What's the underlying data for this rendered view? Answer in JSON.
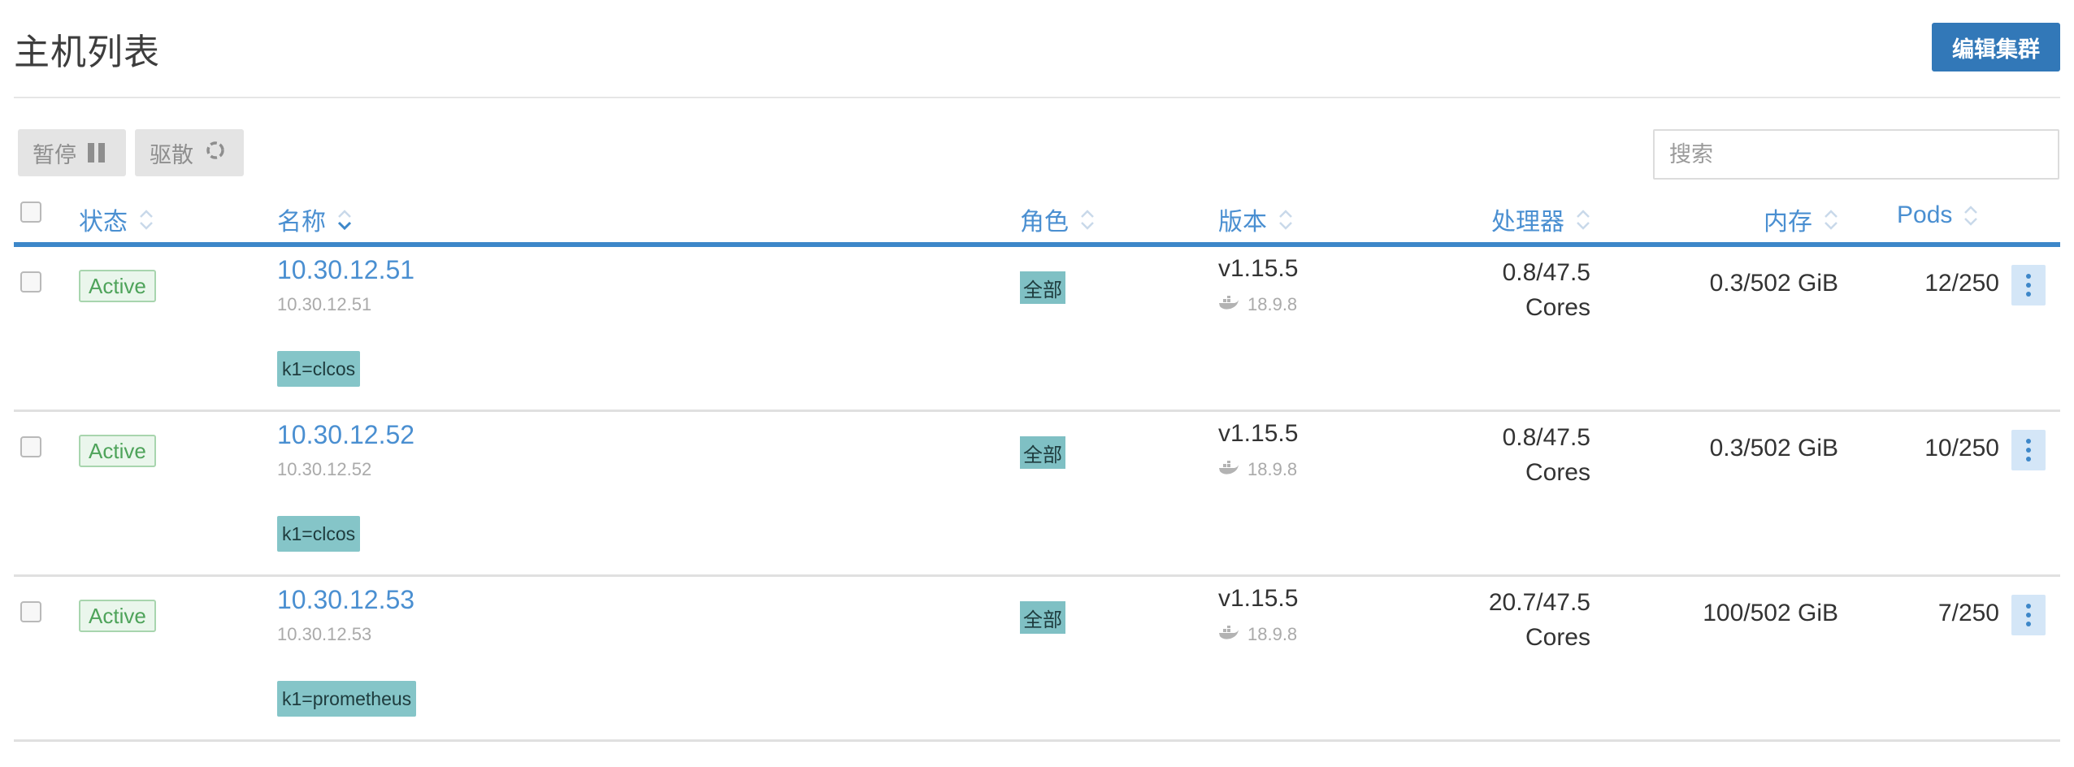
{
  "header": {
    "title": "主机列表",
    "edit_button": "编辑集群"
  },
  "toolbar": {
    "pause_label": "暂停",
    "drain_label": "驱散",
    "search_placeholder": "搜索"
  },
  "table": {
    "columns": {
      "status": "状态",
      "name": "名称",
      "role": "角色",
      "version": "版本",
      "cpu": "处理器",
      "memory": "内存",
      "pods": "Pods"
    },
    "rows": [
      {
        "status": "Active",
        "name": "10.30.12.51",
        "address": "10.30.12.51",
        "label": "k1=clcos",
        "role": "全部",
        "version": "v1.15.5",
        "docker": "18.9.8",
        "cpu": "0.8/47.5",
        "cpu_unit": "Cores",
        "memory": "0.3/502 GiB",
        "pods": "12/250"
      },
      {
        "status": "Active",
        "name": "10.30.12.52",
        "address": "10.30.12.52",
        "label": "k1=clcos",
        "role": "全部",
        "version": "v1.15.5",
        "docker": "18.9.8",
        "cpu": "0.8/47.5",
        "cpu_unit": "Cores",
        "memory": "0.3/502 GiB",
        "pods": "10/250"
      },
      {
        "status": "Active",
        "name": "10.30.12.53",
        "address": "10.30.12.53",
        "label": "k1=prometheus",
        "role": "全部",
        "version": "v1.15.5",
        "docker": "18.9.8",
        "cpu": "20.7/47.5",
        "cpu_unit": "Cores",
        "memory": "100/502 GiB",
        "pods": "7/250"
      }
    ]
  },
  "colors": {
    "primary": "#3278b8",
    "link": "#4a8fd1",
    "active_green": "#4ea35a",
    "label_teal": "#85c5c8"
  },
  "icons": {
    "pause": "pause-icon",
    "drain": "refresh-icon",
    "sort": "sort-icon",
    "sort_active": "chevron-down-icon",
    "docker": "docker-whale-icon",
    "kebab": "kebab-menu-icon"
  }
}
